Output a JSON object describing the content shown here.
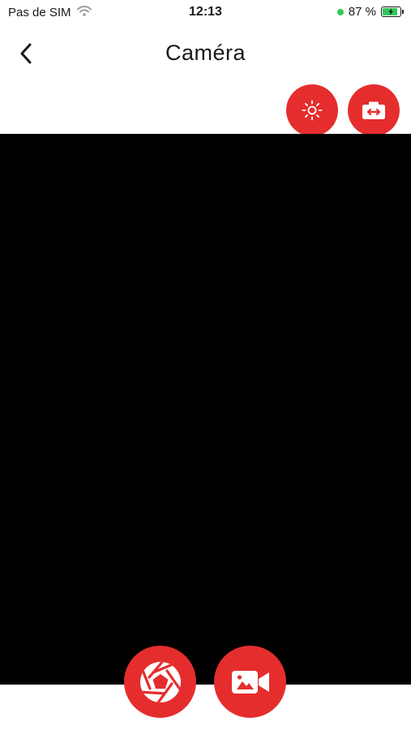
{
  "status_bar": {
    "carrier": "Pas de SIM",
    "time": "12:13",
    "battery_percent": "87 %",
    "battery_level": 0.87,
    "icons": [
      "wifi-icon",
      "location-dot-icon",
      "battery-charging-icon"
    ]
  },
  "nav": {
    "title": "Caméra",
    "back_icon": "chevron-left-icon"
  },
  "controls": {
    "top": [
      "brightness-icon",
      "camera-switch-icon"
    ],
    "bottom": [
      "shutter-aperture-icon",
      "video-camera-icon"
    ]
  },
  "colors": {
    "accent": "#e52d2e",
    "preview_background": "#000000",
    "status_dot": "#34c759",
    "battery_fill": "#34c759",
    "text": "#1a1a1a"
  }
}
